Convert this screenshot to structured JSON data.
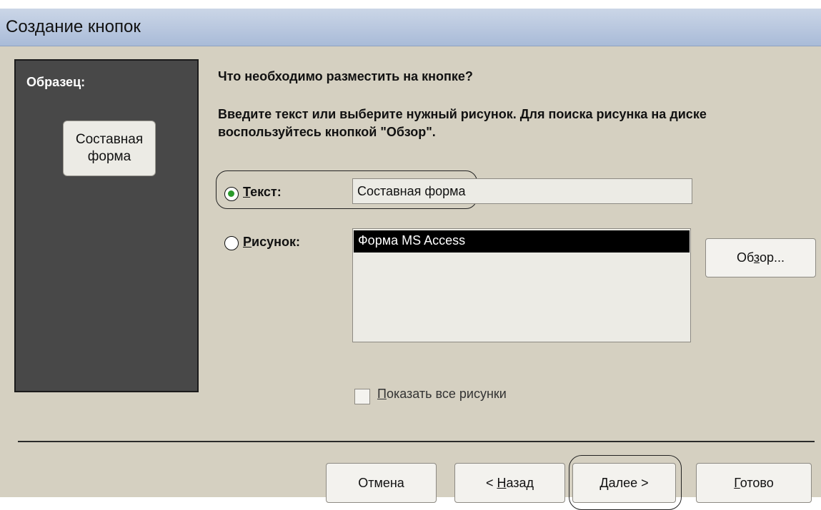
{
  "window": {
    "title": "Создание кнопок"
  },
  "sample": {
    "label": "Образец:",
    "button_line1": "Составная",
    "button_line2": "форма"
  },
  "main": {
    "prompt": "Что необходимо разместить на кнопке?",
    "instruction": "Введите текст или выберите нужный рисунок.  Для поиска рисунка на диске воспользуйтесь кнопкой \"Обзор\"."
  },
  "options": {
    "text_label": "Текст:",
    "text_value": "Составная форма",
    "text_selected": true,
    "picture_label": "Рисунок:",
    "picture_selected": false,
    "pictures": [
      "Форма MS Access"
    ],
    "selected_picture": "Форма MS Access",
    "browse_label": "Обзор...",
    "show_all_label": "Показать все рисунки",
    "show_all_checked": false
  },
  "footer": {
    "cancel_label": "Отмена",
    "back_label": "< Назад",
    "next_label": "Далее >",
    "finish_label": "Готово"
  },
  "colors": {
    "dialog_bg": "#d5d0c1",
    "sample_panel_bg": "#484848",
    "radio_selected": "#2a9a2a",
    "list_selection": "#000000"
  }
}
